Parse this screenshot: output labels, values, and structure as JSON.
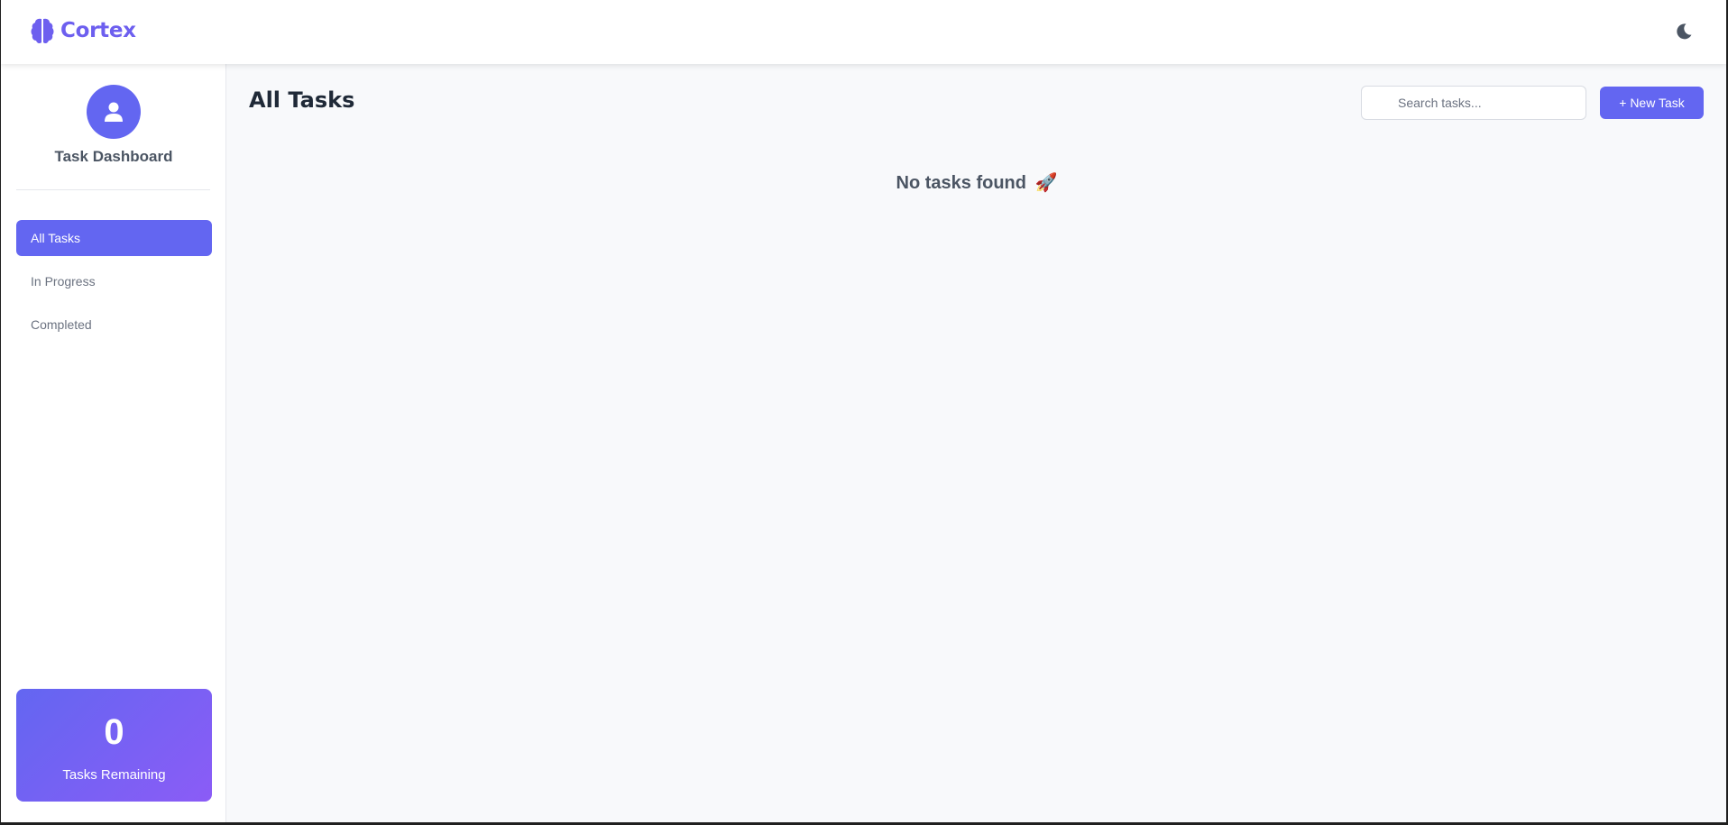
{
  "header": {
    "brand_name": "Cortex",
    "brand_icon": "brain-icon",
    "theme_toggle_icon": "moon-icon",
    "accent_color": "#6d5fef"
  },
  "sidebar": {
    "profile_icon": "user-icon",
    "profile_name": "Task Dashboard",
    "items": [
      {
        "label": "All Tasks",
        "active": true
      },
      {
        "label": "In Progress",
        "active": false
      },
      {
        "label": "Completed",
        "active": false
      }
    ],
    "stats": {
      "count": "0",
      "label": "Tasks Remaining"
    }
  },
  "main": {
    "title": "All Tasks",
    "search": {
      "placeholder": "Search tasks...",
      "value": ""
    },
    "new_task_label": "+ New Task",
    "empty_state": {
      "text": "No tasks found",
      "emoji": "🚀"
    }
  },
  "colors": {
    "primary": "#6366f1",
    "gradient_end": "#8b5cf6",
    "background": "#f8f9fb"
  }
}
